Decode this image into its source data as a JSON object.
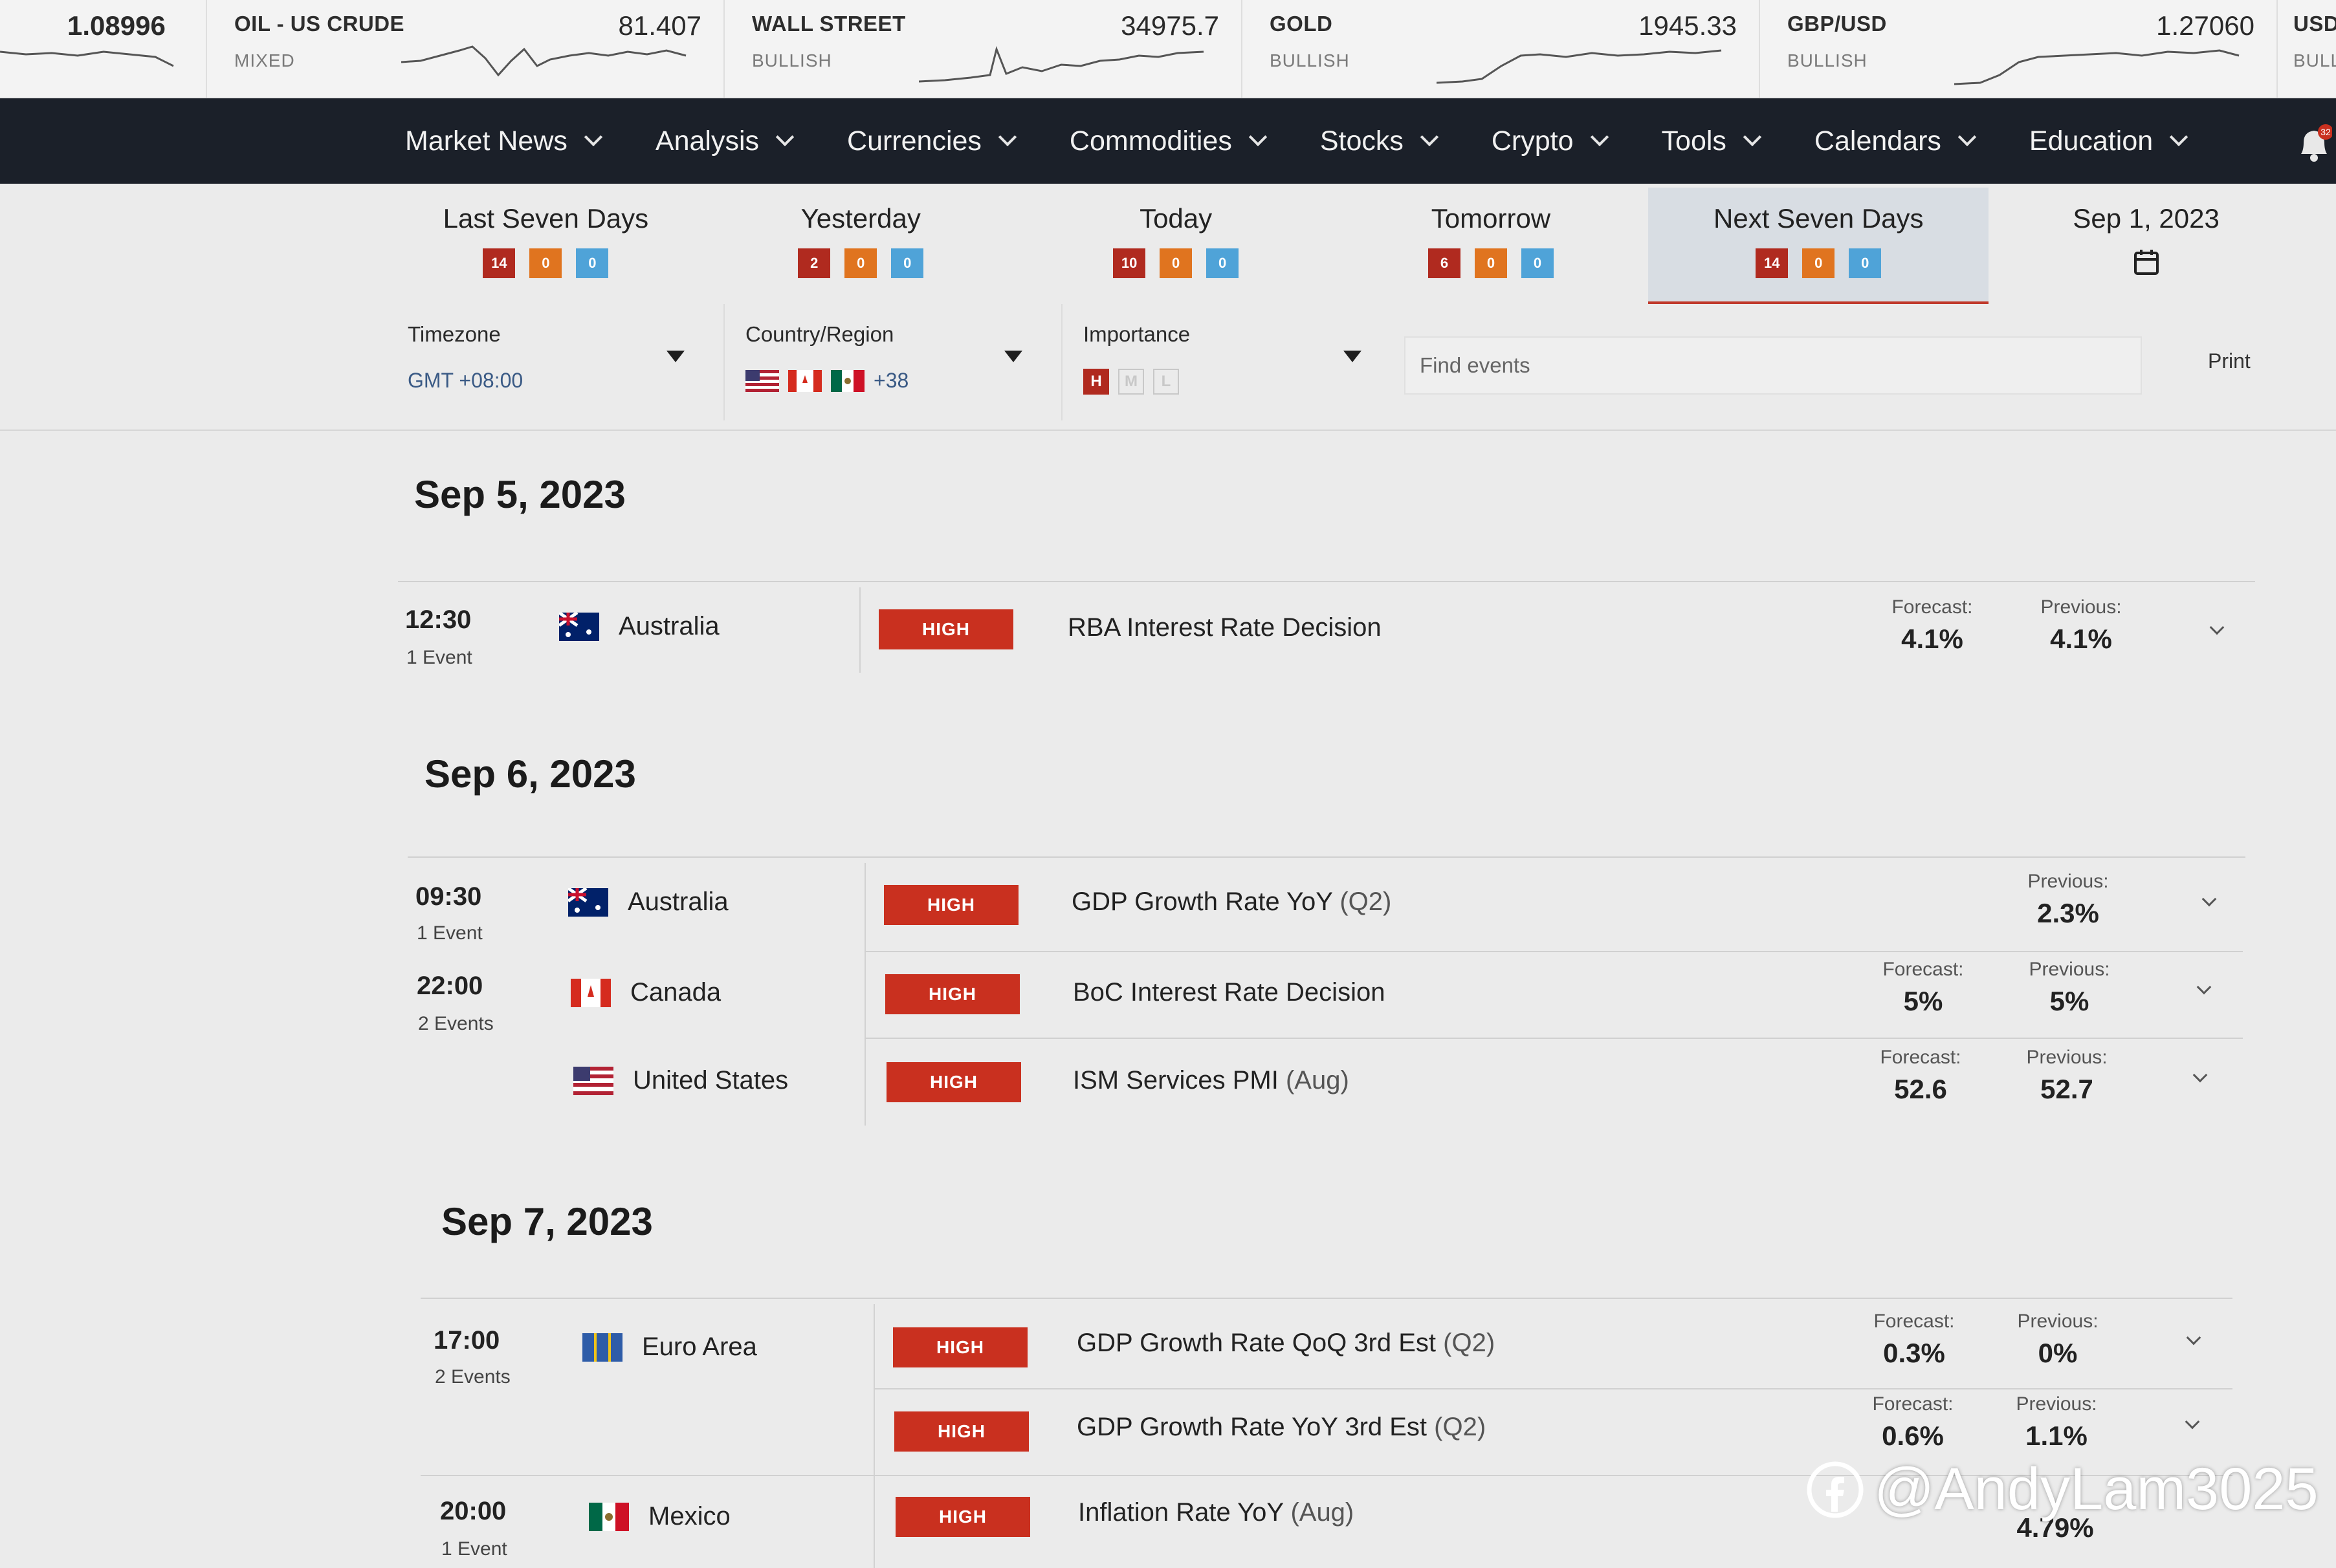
{
  "ticker": [
    {
      "name": "",
      "price": "1.08996",
      "sentiment": ""
    },
    {
      "name": "OIL - US CRUDE",
      "price": "81.407",
      "sentiment": "MIXED"
    },
    {
      "name": "WALL STREET",
      "price": "34975.7",
      "sentiment": "BULLISH"
    },
    {
      "name": "GOLD",
      "price": "1945.33",
      "sentiment": "BULLISH"
    },
    {
      "name": "GBP/USD",
      "price": "1.27060",
      "sentiment": "BULLISH"
    },
    {
      "name": "USD",
      "price": "",
      "sentiment": "BULL"
    }
  ],
  "nav": {
    "items": [
      "Market News",
      "Analysis",
      "Currencies",
      "Commodities",
      "Stocks",
      "Crypto",
      "Tools",
      "Calendars",
      "Education"
    ],
    "bell_count": "32"
  },
  "tabs": [
    {
      "label": "Last Seven Days",
      "high": "14",
      "medium": "0",
      "low": "0"
    },
    {
      "label": "Yesterday",
      "high": "2",
      "medium": "0",
      "low": "0"
    },
    {
      "label": "Today",
      "high": "10",
      "medium": "0",
      "low": "0"
    },
    {
      "label": "Tomorrow",
      "high": "6",
      "medium": "0",
      "low": "0"
    },
    {
      "label": "Next Seven Days",
      "high": "14",
      "medium": "0",
      "low": "0"
    },
    {
      "label": "Sep 1, 2023"
    }
  ],
  "filters": {
    "timezone_label": "Timezone",
    "timezone_value": "GMT +08:00",
    "country_label": "Country/Region",
    "country_extra": "+38",
    "importance_label": "Importance",
    "importance_levels": [
      "H",
      "M",
      "L"
    ],
    "search_placeholder": "Find events",
    "print_label": "Print"
  },
  "labels": {
    "forecast": "Forecast:",
    "previous": "Previous:",
    "high": "HIGH"
  },
  "days": [
    {
      "date": "Sep 5, 2023",
      "groups": [
        {
          "time": "12:30",
          "count": "1 Event",
          "events": [
            {
              "country": "Australia",
              "name": "RBA Interest Rate Decision",
              "period": "",
              "forecast": "4.1%",
              "previous": "4.1%"
            }
          ]
        }
      ]
    },
    {
      "date": "Sep 6, 2023",
      "groups": [
        {
          "time": "09:30",
          "count": "1 Event",
          "events": [
            {
              "country": "Australia",
              "name": "GDP Growth Rate YoY",
              "period": "(Q2)",
              "forecast": "",
              "previous": "2.3%"
            }
          ]
        },
        {
          "time": "22:00",
          "count": "2 Events",
          "events": [
            {
              "country": "Canada",
              "name": "BoC Interest Rate Decision",
              "period": "",
              "forecast": "5%",
              "previous": "5%"
            },
            {
              "country": "United States",
              "name": "ISM Services PMI",
              "period": "(Aug)",
              "forecast": "52.6",
              "previous": "52.7"
            }
          ]
        }
      ]
    },
    {
      "date": "Sep 7, 2023",
      "groups": [
        {
          "time": "17:00",
          "count": "2 Events",
          "events": [
            {
              "country": "Euro Area",
              "name": "GDP Growth Rate QoQ 3rd Est",
              "period": "(Q2)",
              "forecast": "0.3%",
              "previous": "0%"
            },
            {
              "country": "",
              "name": "GDP Growth Rate YoY 3rd Est",
              "period": "(Q2)",
              "forecast": "0.6%",
              "previous": "1.1%"
            }
          ]
        },
        {
          "time": "20:00",
          "count": "1 Event",
          "events": [
            {
              "country": "Mexico",
              "name": "Inflation Rate YoY",
              "period": "(Aug)",
              "forecast": "",
              "previous": "4.79%"
            }
          ]
        }
      ]
    }
  ],
  "watermark": "@AndyLam3025",
  "colors": {
    "nav_bg": "#1b2029",
    "high": "#c9301f",
    "medium": "#e0741f",
    "low": "#4fa3d8",
    "active_tab": "#d8dde3"
  }
}
